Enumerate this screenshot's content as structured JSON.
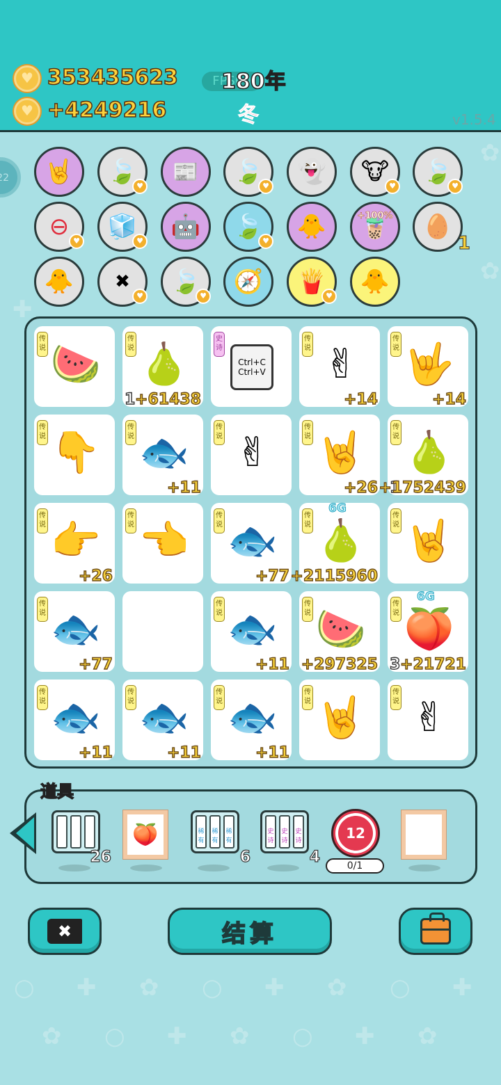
{
  "header": {
    "coins_total": "353435623",
    "coins_rate": "+4249216",
    "year": "180年",
    "season": "冬",
    "fps_label": "FPS60",
    "version": "v1.5.4"
  },
  "buffs": {
    "row1": [
      "rock-hand",
      "leaf",
      "time-magazine",
      "leaf",
      "ghost",
      "cow-girls",
      "leaf"
    ],
    "row2": [
      "minus-circle",
      "sugar-cubes",
      "robot-ghost",
      "leaf",
      "chick-egg",
      "milk-tea",
      "egg-tray"
    ],
    "row3": [
      "chick-egg",
      "delete-tag",
      "leaf",
      "compass",
      "fries",
      "chick-egg"
    ],
    "milk_tea_bonus": "+100%",
    "egg_tray_count": "1"
  },
  "board": {
    "legend_tag": "传说",
    "epic_tag": "史诗",
    "copy_keys": "Ctrl+C\nCtrl+V",
    "cells": [
      {
        "tag": "传说",
        "item": "watermelon",
        "val": "",
        "lvl": ""
      },
      {
        "tag": "传说",
        "item": "pear",
        "val": "+61438",
        "lvl": "1"
      },
      {
        "tag": "史诗",
        "item": "copy-paste",
        "val": "",
        "lvl": ""
      },
      {
        "tag": "传说",
        "item": "hand-peace-down",
        "val": "+14",
        "lvl": ""
      },
      {
        "tag": "传说",
        "item": "hand-rock",
        "val": "+14",
        "lvl": ""
      },
      {
        "tag": "传说",
        "item": "hand-point-down",
        "val": "",
        "lvl": ""
      },
      {
        "tag": "传说",
        "item": "fish",
        "val": "+11",
        "lvl": ""
      },
      {
        "tag": "传说",
        "item": "hand-peace-down",
        "val": "",
        "lvl": ""
      },
      {
        "tag": "传说",
        "item": "hand-rock-up",
        "val": "+26",
        "lvl": ""
      },
      {
        "tag": "传说",
        "item": "pear",
        "val": "+1752439",
        "lvl": "1"
      },
      {
        "tag": "传说",
        "item": "hand-point-right",
        "val": "+26",
        "lvl": ""
      },
      {
        "tag": "传说",
        "item": "hand-point-left",
        "val": "",
        "lvl": ""
      },
      {
        "tag": "传说",
        "item": "fish",
        "val": "+77",
        "lvl": ""
      },
      {
        "tag": "传说",
        "item": "pear",
        "val": "+2115960",
        "lvl": "",
        "gen": "6G"
      },
      {
        "tag": "传说",
        "item": "hand-rock-up",
        "val": "",
        "lvl": ""
      },
      {
        "tag": "传说",
        "item": "fish",
        "val": "+77",
        "lvl": ""
      },
      {
        "tag": "",
        "item": "empty",
        "val": "",
        "lvl": ""
      },
      {
        "tag": "传说",
        "item": "fish",
        "val": "+11",
        "lvl": ""
      },
      {
        "tag": "传说",
        "item": "watermelon",
        "val": "+297325",
        "lvl": ""
      },
      {
        "tag": "传说",
        "item": "pomelo",
        "val": "+21721",
        "lvl": "3",
        "gen": "6G"
      },
      {
        "tag": "传说",
        "item": "fish",
        "val": "+11",
        "lvl": ""
      },
      {
        "tag": "传说",
        "item": "fish",
        "val": "+11",
        "lvl": ""
      },
      {
        "tag": "传说",
        "item": "fish",
        "val": "+11",
        "lvl": ""
      },
      {
        "tag": "传说",
        "item": "hand-rock-up",
        "val": "",
        "lvl": ""
      },
      {
        "tag": "传说",
        "item": "hand-peace-down",
        "val": "",
        "lvl": ""
      }
    ]
  },
  "props": {
    "title": "道具",
    "items": [
      {
        "name": "blank-slots",
        "count": "26",
        "slot_label": ""
      },
      {
        "name": "framed-pomelo",
        "count": ""
      },
      {
        "name": "rare-slots",
        "count": "6",
        "slot_label": "稀有"
      },
      {
        "name": "epic-slots",
        "count": "4",
        "slot_label": "史诗"
      },
      {
        "name": "target",
        "count": "12",
        "progress": "0/1"
      },
      {
        "name": "empty-frame",
        "count": ""
      }
    ]
  },
  "actions": {
    "settle_label": "结算"
  },
  "colors": {
    "topbar": "#2ec6c5",
    "background": "#a9e0e4",
    "coin_text": "#fbd23c",
    "legend_tag": "#fff58c",
    "epic_tag": "#f6c1f1"
  }
}
